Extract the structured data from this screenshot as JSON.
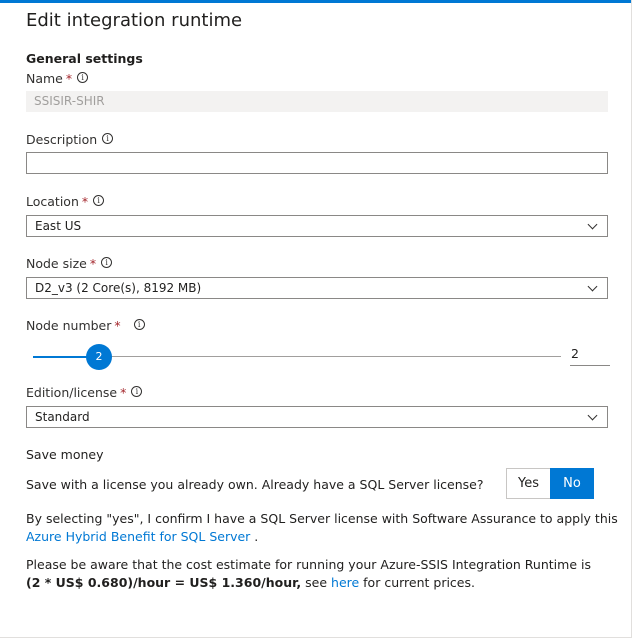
{
  "dialog": {
    "title": "Edit integration runtime",
    "section": "General settings"
  },
  "fields": {
    "name": {
      "label": "Name",
      "required": "*",
      "value": "SSISIR-SHIR"
    },
    "description": {
      "label": "Description",
      "value": ""
    },
    "location": {
      "label": "Location",
      "required": "*",
      "value": "East US"
    },
    "node_size": {
      "label": "Node size",
      "required": "*",
      "value": "D2_v3 (2 Core(s), 8192 MB)"
    },
    "node_number": {
      "label": "Node number",
      "required": "*",
      "value": "2",
      "slider_value": "2",
      "min": 1,
      "max": 10
    },
    "edition": {
      "label": "Edition/license",
      "required": "*",
      "value": "Standard"
    }
  },
  "save_money": {
    "heading": "Save money",
    "question": "Save with a license you already own. Already have a SQL Server license?",
    "yes_label": "Yes",
    "no_label": "No",
    "selected": "No",
    "confirm_text": "By selecting \"yes\", I confirm I have a SQL Server license with Software Assurance to apply this",
    "benefit_link": "Azure Hybrid Benefit for SQL Server",
    "benefit_suffix": " ."
  },
  "cost": {
    "line1": "Please be aware that the cost estimate for running your Azure-SSIS Integration Runtime is",
    "estimate": "(2 * US$ 0.680)/hour = US$ 1.360/hour,",
    "see": " see ",
    "here_link": "here",
    "suffix": " for current prices."
  },
  "icons": {
    "info": "info-icon",
    "dropdown": "chevron-down-icon"
  },
  "colors": {
    "accent": "#0078d4",
    "required": "#a4262c",
    "disabled_bg": "#f3f2f1"
  }
}
